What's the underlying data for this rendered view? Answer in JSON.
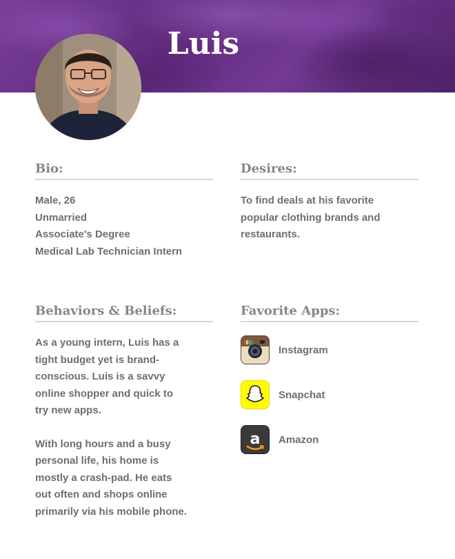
{
  "persona": {
    "name": "Luis",
    "avatar_icon": "person-photo"
  },
  "colors": {
    "banner": "#5f2a7d",
    "heading_text": "#868686",
    "body_text": "#6e6e6e",
    "rule": "#d6d6d6",
    "snapchat_yellow": "#fffc00"
  },
  "bio": {
    "heading": "Bio:",
    "lines": [
      "Male, 26",
      "Unmarried",
      "Associate's Degree",
      "Medical Lab Technician Intern"
    ]
  },
  "desires": {
    "heading": "Desires:",
    "lines": [
      "To find deals at his favorite",
      "popular clothing brands and",
      "restaurants."
    ]
  },
  "behaviors": {
    "heading": "Behaviors & Beliefs:",
    "paragraph1": [
      "As a young intern, Luis has a",
      "tight budget yet is brand-",
      "conscious. Luis is a savvy",
      "online shopper and quick to",
      "try new apps."
    ],
    "paragraph2": [
      "With long hours and a busy",
      "personal life, his home is",
      "mostly a crash-pad. He eats",
      "out often and shops online",
      "primarily via his mobile phone."
    ]
  },
  "apps": {
    "heading": "Favorite Apps:",
    "items": [
      {
        "label": "Instagram",
        "icon": "instagram-icon"
      },
      {
        "label": "Snapchat",
        "icon": "snapchat-icon"
      },
      {
        "label": "Amazon",
        "icon": "amazon-icon"
      }
    ]
  }
}
